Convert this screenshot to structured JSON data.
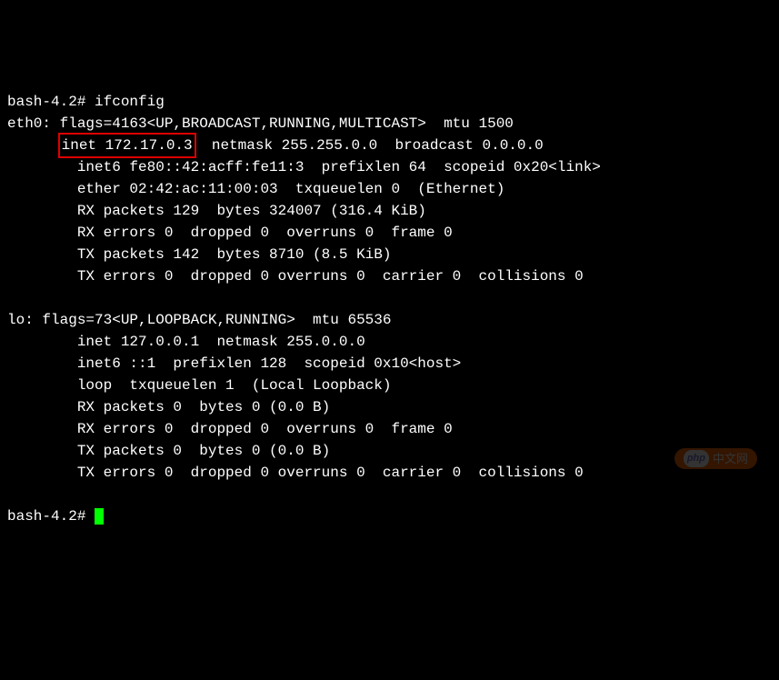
{
  "prompt1": "bash-4.2# ",
  "cmd1": "ifconfig",
  "eth0": {
    "header": "eth0: flags=4163<UP,BROADCAST,RUNNING,MULTICAST>  mtu 1500",
    "inet_highlight": "inet 172.17.0.3",
    "inet_rest": "  netmask 255.255.0.0  broadcast 0.0.0.0",
    "inet6": "inet6 fe80::42:acff:fe11:3  prefixlen 64  scopeid 0x20<link>",
    "ether": "ether 02:42:ac:11:00:03  txqueuelen 0  (Ethernet)",
    "rx_packets": "RX packets 129  bytes 324007 (316.4 KiB)",
    "rx_errors": "RX errors 0  dropped 0  overruns 0  frame 0",
    "tx_packets": "TX packets 142  bytes 8710 (8.5 KiB)",
    "tx_errors": "TX errors 0  dropped 0 overruns 0  carrier 0  collisions 0"
  },
  "lo": {
    "header": "lo: flags=73<UP,LOOPBACK,RUNNING>  mtu 65536",
    "inet": "inet 127.0.0.1  netmask 255.0.0.0",
    "inet6": "inet6 ::1  prefixlen 128  scopeid 0x10<host>",
    "loop": "loop  txqueuelen 1  (Local Loopback)",
    "rx_packets": "RX packets 0  bytes 0 (0.0 B)",
    "rx_errors": "RX errors 0  dropped 0  overruns 0  frame 0",
    "tx_packets": "TX packets 0  bytes 0 (0.0 B)",
    "tx_errors": "TX errors 0  dropped 0 overruns 0  carrier 0  collisions 0"
  },
  "prompt2": "bash-4.2# ",
  "watermark": "中文网",
  "indent": "        ",
  "indent2": "      "
}
